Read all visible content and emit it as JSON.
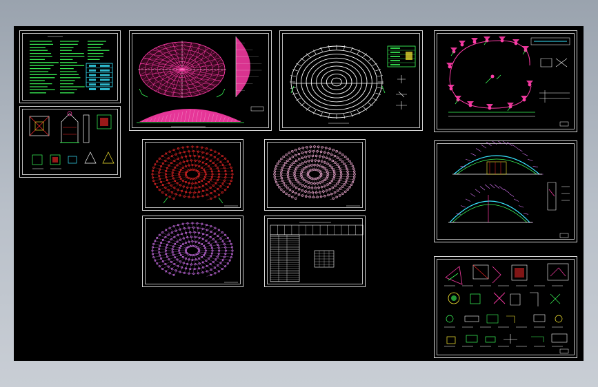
{
  "viewport": {
    "background": "#000000",
    "desktop_gradient": [
      "#9aa3ae",
      "#c9ced5"
    ]
  },
  "colors": {
    "magenta": "#ff3ca8",
    "red": "#ff2a2a",
    "pink": "#ffb6e0",
    "violet": "#e07aff",
    "green": "#3cff5a",
    "cyan": "#38e6ff",
    "white": "#ffffff",
    "yellow": "#ffee33"
  },
  "sheets": [
    {
      "id": "notes",
      "kind": "general-notes"
    },
    {
      "id": "embed-details",
      "kind": "details"
    },
    {
      "id": "dome-plan-elevation",
      "kind": "dome-plan"
    },
    {
      "id": "ring-plan",
      "kind": "ring-plan"
    },
    {
      "id": "support-plan",
      "kind": "support-plan"
    },
    {
      "id": "layout-red",
      "kind": "grid-layout"
    },
    {
      "id": "layout-pink",
      "kind": "grid-layout"
    },
    {
      "id": "layout-violet",
      "kind": "grid-layout"
    },
    {
      "id": "member-table",
      "kind": "table"
    },
    {
      "id": "sections",
      "kind": "sections"
    },
    {
      "id": "node-details",
      "kind": "details"
    }
  ]
}
